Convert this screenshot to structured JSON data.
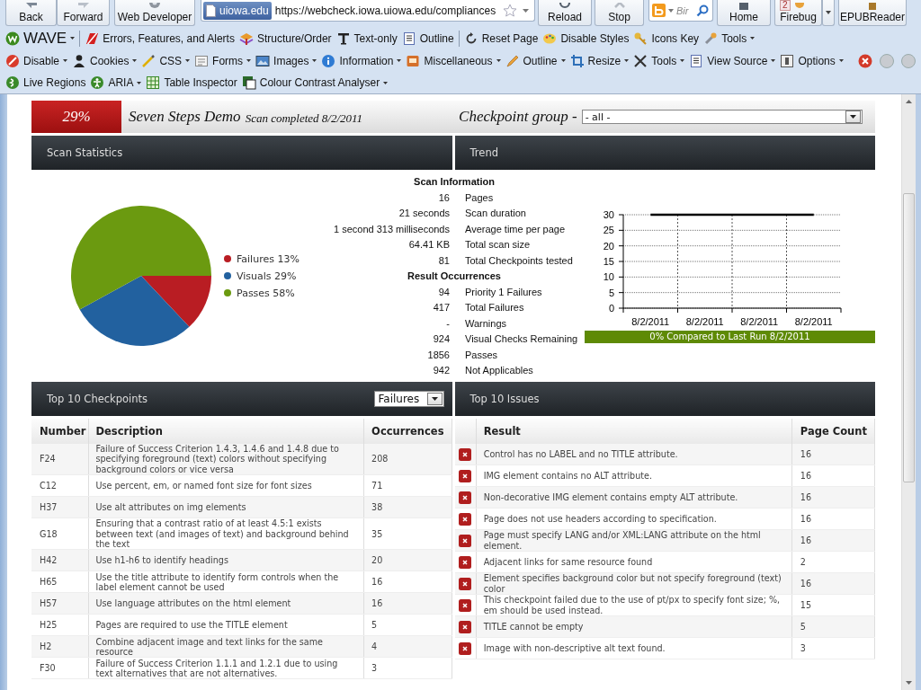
{
  "nav": {
    "back": "Back",
    "forward": "Forward",
    "web_developer": "Web Developer",
    "site_badge": "uiowa.edu",
    "url": "https://webcheck.iowa.uiowa.edu/compliances",
    "reload": "Reload",
    "stop": "Stop",
    "search_placeholder": "Bir",
    "home": "Home",
    "firebug_badge": "2",
    "firebug": "Firebug",
    "epubreader": "EPUBReader"
  },
  "wave_toolbar": {
    "items": [
      {
        "label": "WAVE",
        "dropdown": true,
        "divider_after": true
      },
      {
        "label": "Errors, Features, and Alerts",
        "dropdown": false,
        "divider_after": false
      },
      {
        "label": "Structure/Order",
        "dropdown": false,
        "divider_after": false
      },
      {
        "label": "Text-only",
        "dropdown": false,
        "divider_after": false
      },
      {
        "label": "Outline",
        "dropdown": false,
        "divider_after": true
      },
      {
        "label": "Reset Page",
        "dropdown": false,
        "divider_after": false
      },
      {
        "label": "Disable Styles",
        "dropdown": false,
        "divider_after": false
      },
      {
        "label": "Icons Key",
        "dropdown": false,
        "divider_after": false
      },
      {
        "label": "Tools",
        "dropdown": true,
        "divider_after": false
      }
    ]
  },
  "webdev_toolbar": {
    "items": [
      {
        "label": "Disable",
        "dropdown": true
      },
      {
        "label": "Cookies",
        "dropdown": true
      },
      {
        "label": "CSS",
        "dropdown": true
      },
      {
        "label": "Forms",
        "dropdown": true
      },
      {
        "label": "Images",
        "dropdown": true
      },
      {
        "label": "Information",
        "dropdown": true
      },
      {
        "label": "Miscellaneous",
        "dropdown": true
      },
      {
        "label": "Outline",
        "dropdown": true
      },
      {
        "label": "Resize",
        "dropdown": true
      },
      {
        "label": "Tools",
        "dropdown": true
      },
      {
        "label": "View Source",
        "dropdown": true
      },
      {
        "label": "Options",
        "dropdown": true
      }
    ]
  },
  "accessibility_toolbar": {
    "items": [
      {
        "label": "Live Regions",
        "dropdown": false
      },
      {
        "label": "ARIA",
        "dropdown": true
      },
      {
        "label": "Table Inspector",
        "dropdown": false
      },
      {
        "label": "Colour Contrast Analyser",
        "dropdown": true
      }
    ]
  },
  "header": {
    "score": "29%",
    "title": "Seven Steps Demo",
    "subtitle": "Scan completed 8/2/2011",
    "group_label": "Checkpoint group -",
    "group_value": "- all -"
  },
  "stats": {
    "title": "Scan Statistics",
    "pie": {
      "chart_data": {
        "type": "pie",
        "categories": [
          "Failures",
          "Visuals",
          "Passes"
        ],
        "values": [
          13,
          29,
          58
        ],
        "value_labels": [
          "13%",
          "29%",
          "58%"
        ]
      }
    },
    "legend": [
      {
        "color": "#b91d23"
      },
      {
        "color": "#22619f"
      },
      {
        "color": "#6b9a10"
      }
    ],
    "info": [
      {
        "heading": "Scan Information",
        "rows": [
          {
            "value": "16",
            "label": "Pages"
          },
          {
            "value": "21 seconds",
            "label": "Scan duration"
          },
          {
            "value": "1 second 313 milliseconds",
            "label": "Average time per page"
          },
          {
            "value": "64.41 KB",
            "label": "Total scan size"
          },
          {
            "value": "81",
            "label": "Total Checkpoints tested"
          }
        ]
      },
      {
        "heading": "Result Occurrences",
        "rows": [
          {
            "value": "94",
            "label": "Priority 1 Failures"
          },
          {
            "value": "417",
            "label": "Total Failures"
          },
          {
            "value": "-",
            "label": "Warnings"
          },
          {
            "value": "924",
            "label": "Visual Checks Remaining"
          },
          {
            "value": "1856",
            "label": "Passes"
          },
          {
            "value": "942",
            "label": "Not Applicables"
          }
        ]
      }
    ]
  },
  "trend": {
    "title": "Trend",
    "chart_data": {
      "type": "line",
      "categories": [
        "8/2/2011",
        "8/2/2011",
        "8/2/2011",
        "8/2/2011"
      ],
      "series": [
        {
          "color": "#000000",
          "values": [
            30,
            30,
            30,
            30
          ]
        }
      ],
      "ylim": [
        0,
        30
      ],
      "yticks": [
        0,
        5,
        10,
        15,
        20,
        25,
        30
      ],
      "grid": true
    },
    "comparison": "0% Compared to Last Run 8/2/2011"
  },
  "checkpoints": {
    "title": "Top 10 Checkpoints",
    "filter": "Failures",
    "columns": [
      "Number",
      "Description",
      "Occurrences"
    ],
    "rows": [
      {
        "number": "F24",
        "description": "Failure of Success Criterion 1.4.3, 1.4.6 and 1.4.8 due to specifying foreground (text) colors without specifying background colors or vice versa",
        "occurrences": "208"
      },
      {
        "number": "C12",
        "description": "Use percent, em, or named font size for font sizes",
        "occurrences": "71"
      },
      {
        "number": "H37",
        "description": "Use alt attributes on img elements",
        "occurrences": "38"
      },
      {
        "number": "G18",
        "description": "Ensuring that a contrast ratio of at least 4.5:1 exists between text (and images of text) and background behind the text",
        "occurrences": "35"
      },
      {
        "number": "H42",
        "description": "Use h1-h6 to identify headings",
        "occurrences": "20"
      },
      {
        "number": "H65",
        "description": "Use the title attribute to identify form controls when the label element cannot be used",
        "occurrences": "16"
      },
      {
        "number": "H57",
        "description": "Use language attributes on the html element",
        "occurrences": "16"
      },
      {
        "number": "H25",
        "description": "Pages are required to use the TITLE element",
        "occurrences": "5"
      },
      {
        "number": "H2",
        "description": "Combine adjacent image and text links for the same resource",
        "occurrences": "4"
      },
      {
        "number": "F30",
        "description": "Failure of Success Criterion 1.1.1 and 1.2.1 due to using text alternatives that are not alternatives.",
        "occurrences": "3"
      }
    ]
  },
  "issues": {
    "title": "Top 10 Issues",
    "columns": [
      "Result",
      "Page Count"
    ],
    "rows": [
      {
        "result": "Control has no LABEL and no TITLE attribute.",
        "page_count": "16"
      },
      {
        "result": "IMG element contains no ALT attribute.",
        "page_count": "16"
      },
      {
        "result": "Non-decorative IMG element contains empty ALT attribute.",
        "page_count": "16"
      },
      {
        "result": "Page does not use headers according to specification.",
        "page_count": "16"
      },
      {
        "result": "Page must specify LANG and/or XML:LANG attribute on the html element.",
        "page_count": "16"
      },
      {
        "result": "Adjacent links for same resource found",
        "page_count": "2"
      },
      {
        "result": "Element specifies background color but not specify foreground (text) color",
        "page_count": "16"
      },
      {
        "result": "This checkpoint failed due to the use of pt/px to specify font size; %, em should be used instead.",
        "page_count": "15"
      },
      {
        "result": "TITLE cannot be empty",
        "page_count": "5"
      },
      {
        "result": "Image with non-descriptive alt text found.",
        "page_count": "3"
      }
    ]
  }
}
